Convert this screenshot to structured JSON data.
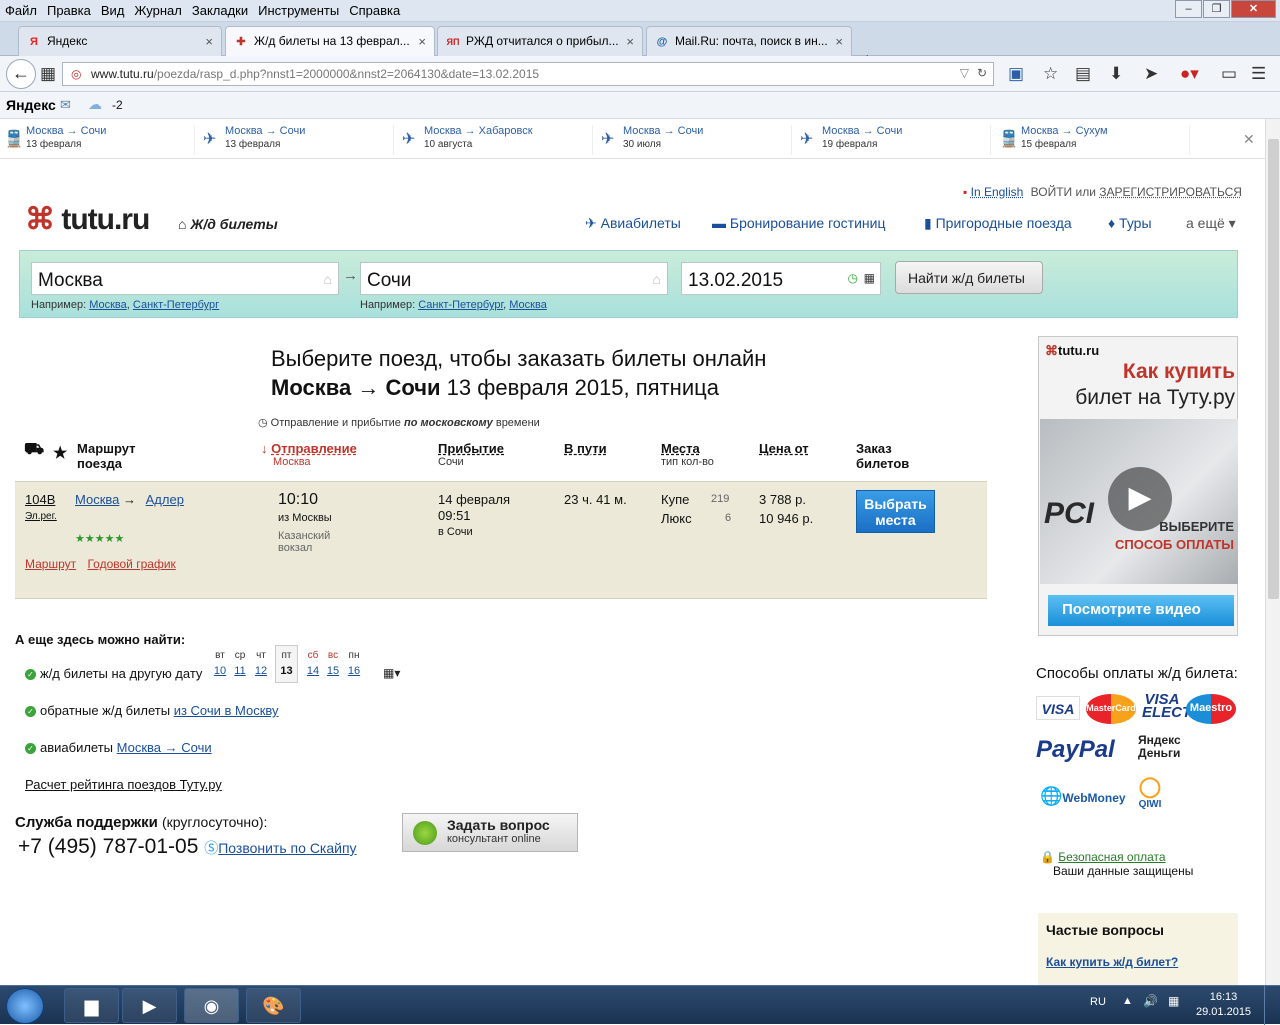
{
  "menubar": {
    "items": [
      "Файл",
      "Правка",
      "Вид",
      "Журнал",
      "Закладки",
      "Инструменты",
      "Справка"
    ]
  },
  "tabs": [
    {
      "label": "Яндекс",
      "icon": "Я"
    },
    {
      "label": "Ж/д билеты на 13 феврал...",
      "icon": "✚"
    },
    {
      "label": "РЖД отчитался о прибыл...",
      "icon": "ЯП"
    },
    {
      "label": "Mail.Ru: почта, поиск в ин...",
      "icon": "@"
    }
  ],
  "url": {
    "host": "www.tutu.ru",
    "path": "/poezda/rasp_d.php?nnst1=2000000&nnst2=2064130&date=13.02.2015"
  },
  "yandexbar": {
    "brand": "Яндекс",
    "weather": "-2"
  },
  "recent": [
    {
      "route": "Москва → Сочи",
      "date": "13 февраля",
      "icon": "train-icon"
    },
    {
      "route": "Москва → Сочи",
      "date": "13 февраля",
      "icon": "plane-icon"
    },
    {
      "route": "Москва → Хабаровск",
      "date": "10 августа",
      "icon": "plane-icon"
    },
    {
      "route": "Москва → Сочи",
      "date": "30 июля",
      "icon": "plane-icon"
    },
    {
      "route": "Москва → Сочи",
      "date": "19 февраля",
      "icon": "plane-icon"
    },
    {
      "route": "Москва → Сухум",
      "date": "15 февраля",
      "icon": "train-icon"
    }
  ],
  "header": {
    "english": "In English",
    "login": "ВОЙТИ",
    "or": "или",
    "register": "ЗАРЕГИСТРИРОВАТЬСЯ",
    "logo": "tutu.ru",
    "section": "Ж/д билеты",
    "nav": [
      "Авиабилеты",
      "Бронирование гостиниц",
      "Пригородные поезда",
      "Туры",
      "а ещё"
    ]
  },
  "search": {
    "from": "Москва",
    "to": "Сочи",
    "date": "13.02.2015",
    "button": "Найти ж/д билеты",
    "hint_label": "Например:",
    "from_hints": [
      "Москва",
      "Санкт-Петербург"
    ],
    "to_hints": [
      "Санкт-Петербург",
      "Москва"
    ]
  },
  "headline": {
    "line1": "Выберите поезд, чтобы заказать билеты онлайн",
    "from": "Москва",
    "to": "Сочи",
    "date": "13 февраля 2015, пятница"
  },
  "tznote": {
    "pre": "Отправление и прибытие",
    "em": "по московскому",
    "post": "времени"
  },
  "table": {
    "headers": {
      "route": "Маршрут поезда",
      "departure": "Отправление",
      "departure_sub": "Москва",
      "arrival": "Прибытие",
      "arrival_sub": "Сочи",
      "duration": "В пути",
      "seats": "Места",
      "seats_sub": "тип кол-во",
      "price": "Цена от",
      "order": "Заказ билетов"
    },
    "row": {
      "number": "104В",
      "type": "Эл.рег.",
      "from": "Москва",
      "to": "Адлер",
      "stars": "★★★★★",
      "links": [
        "Маршрут",
        "Годовой график"
      ],
      "dep_time": "10:10",
      "dep_from": "из Москвы",
      "dep_station": "Казанский вокзал",
      "arr_date": "14 февраля",
      "arr_time": "09:51",
      "arr_to": "в Сочи",
      "duration": "23 ч. 41 м.",
      "classes": [
        {
          "name": "Купе",
          "count": "219",
          "price": "3 788 р."
        },
        {
          "name": "Люкс",
          "count": "6",
          "price": "10 946 р."
        }
      ],
      "button": "Выбрать места"
    }
  },
  "more": {
    "title": "А еще здесь можно найти:",
    "other_date": "ж/д билеты на другую дату",
    "days": [
      {
        "d": "вт",
        "n": "10"
      },
      {
        "d": "ср",
        "n": "11"
      },
      {
        "d": "чт",
        "n": "12"
      },
      {
        "d": "пт",
        "n": "13"
      },
      {
        "d": "сб",
        "n": "14"
      },
      {
        "d": "вс",
        "n": "15"
      },
      {
        "d": "пн",
        "n": "16"
      }
    ],
    "return_pre": "обратные ж/д билеты",
    "return_link": "из Сочи в Москву",
    "avia_pre": "авиабилеты",
    "avia_link": "Москва → Сочи",
    "rating": "Расчет рейтинга поездов Туту.ру"
  },
  "support": {
    "title": "Служба поддержки",
    "hours": "(круглосуточно):",
    "phone": "+7 (495) 787-01-05",
    "skype": "Позвонить по Скайпу",
    "ask": "Задать вопрос",
    "ask_sub": "консультант online"
  },
  "ad": {
    "logo": "tutu.ru",
    "title1": "Как купить",
    "title2": "билет на Туту.ру",
    "choose1": "ВЫБЕРИТЕ",
    "choose2": "СПОСОБ ОПЛАТЫ",
    "button": "Посмотрите видео"
  },
  "payments": {
    "title": "Способы оплаты ж/д билета:",
    "methods": [
      "VISA",
      "MasterCard",
      "VISA ELECTRON",
      "Maestro",
      "PayPal",
      "Яндекс Деньги",
      "WebMoney",
      "QIWI"
    ]
  },
  "secure": {
    "title": "Безопасная оплата",
    "sub": "Ваши данные защищены"
  },
  "faq": {
    "title": "Частые вопросы",
    "q1": "Как купить ж/д билет?"
  },
  "taskbar": {
    "lang": "RU",
    "time": "16:13",
    "date": "29.01.2015"
  },
  "colors": {
    "link": "#1a4f9c",
    "red": "#c0352b",
    "accent": "#1a6fc4",
    "row_bg": "#ece9d8"
  }
}
